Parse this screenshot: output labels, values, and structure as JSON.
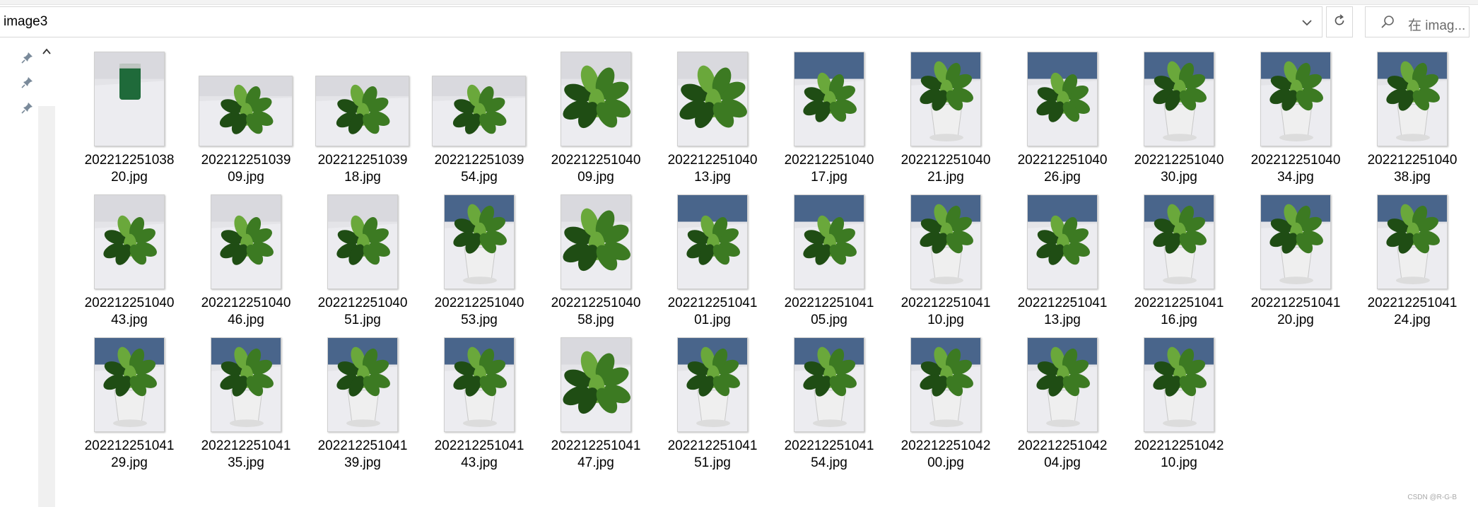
{
  "address": {
    "path": "image3",
    "search_placeholder": "在 imag..."
  },
  "icons": {
    "dropdown": "chevron-down-icon",
    "refresh": "refresh-icon",
    "search": "search-icon",
    "pin": "pin-icon",
    "scroll_up": "chevron-up-icon"
  },
  "files": [
    {
      "line1": "202212251038",
      "line2": "20.jpg",
      "orient": "portrait",
      "scene": "can"
    },
    {
      "line1": "202212251039",
      "line2": "09.jpg",
      "orient": "landscape",
      "scene": "plant-top"
    },
    {
      "line1": "202212251039",
      "line2": "18.jpg",
      "orient": "landscape",
      "scene": "plant-top"
    },
    {
      "line1": "202212251039",
      "line2": "54.jpg",
      "orient": "landscape",
      "scene": "plant-top"
    },
    {
      "line1": "202212251040",
      "line2": "09.jpg",
      "orient": "portrait",
      "scene": "plant-close"
    },
    {
      "line1": "202212251040",
      "line2": "13.jpg",
      "orient": "portrait",
      "scene": "plant-close"
    },
    {
      "line1": "202212251040",
      "line2": "17.jpg",
      "orient": "portrait",
      "scene": "plant-office"
    },
    {
      "line1": "202212251040",
      "line2": "21.jpg",
      "orient": "portrait",
      "scene": "plant-pot"
    },
    {
      "line1": "202212251040",
      "line2": "26.jpg",
      "orient": "portrait",
      "scene": "plant-office"
    },
    {
      "line1": "202212251040",
      "line2": "30.jpg",
      "orient": "portrait",
      "scene": "plant-pot"
    },
    {
      "line1": "202212251040",
      "line2": "34.jpg",
      "orient": "portrait",
      "scene": "plant-pot"
    },
    {
      "line1": "202212251040",
      "line2": "38.jpg",
      "orient": "portrait",
      "scene": "plant-pot"
    },
    {
      "line1": "202212251040",
      "line2": "43.jpg",
      "orient": "portrait",
      "scene": "plant-top"
    },
    {
      "line1": "202212251040",
      "line2": "46.jpg",
      "orient": "portrait",
      "scene": "plant-top"
    },
    {
      "line1": "202212251040",
      "line2": "51.jpg",
      "orient": "portrait",
      "scene": "plant-top"
    },
    {
      "line1": "202212251040",
      "line2": "53.jpg",
      "orient": "portrait",
      "scene": "plant-pot"
    },
    {
      "line1": "202212251040",
      "line2": "58.jpg",
      "orient": "portrait",
      "scene": "plant-close"
    },
    {
      "line1": "202212251041",
      "line2": "01.jpg",
      "orient": "portrait",
      "scene": "plant-office"
    },
    {
      "line1": "202212251041",
      "line2": "05.jpg",
      "orient": "portrait",
      "scene": "plant-office"
    },
    {
      "line1": "202212251041",
      "line2": "10.jpg",
      "orient": "portrait",
      "scene": "plant-pot"
    },
    {
      "line1": "202212251041",
      "line2": "13.jpg",
      "orient": "portrait",
      "scene": "plant-office"
    },
    {
      "line1": "202212251041",
      "line2": "16.jpg",
      "orient": "portrait",
      "scene": "plant-pot"
    },
    {
      "line1": "202212251041",
      "line2": "20.jpg",
      "orient": "portrait",
      "scene": "plant-pot"
    },
    {
      "line1": "202212251041",
      "line2": "24.jpg",
      "orient": "portrait",
      "scene": "plant-pot"
    },
    {
      "line1": "202212251041",
      "line2": "29.jpg",
      "orient": "portrait",
      "scene": "plant-pot"
    },
    {
      "line1": "202212251041",
      "line2": "35.jpg",
      "orient": "portrait",
      "scene": "plant-pot"
    },
    {
      "line1": "202212251041",
      "line2": "39.jpg",
      "orient": "portrait",
      "scene": "plant-pot"
    },
    {
      "line1": "202212251041",
      "line2": "43.jpg",
      "orient": "portrait",
      "scene": "plant-pot"
    },
    {
      "line1": "202212251041",
      "line2": "47.jpg",
      "orient": "portrait",
      "scene": "plant-close"
    },
    {
      "line1": "202212251041",
      "line2": "51.jpg",
      "orient": "portrait",
      "scene": "plant-pot"
    },
    {
      "line1": "202212251041",
      "line2": "54.jpg",
      "orient": "portrait",
      "scene": "plant-pot"
    },
    {
      "line1": "202212251042",
      "line2": "00.jpg",
      "orient": "portrait",
      "scene": "plant-pot"
    },
    {
      "line1": "202212251042",
      "line2": "04.jpg",
      "orient": "portrait",
      "scene": "plant-pot"
    },
    {
      "line1": "202212251042",
      "line2": "10.jpg",
      "orient": "portrait",
      "scene": "plant-pot"
    }
  ],
  "watermark": "CSDN @R-G-B",
  "colors": {
    "leaf_dark": "#1f4d14",
    "leaf": "#3c7a22",
    "leaf_light": "#6aa83b",
    "desk": "#e4e4e8",
    "office_blue": "#2e4f7a",
    "pot": "#efefef"
  }
}
